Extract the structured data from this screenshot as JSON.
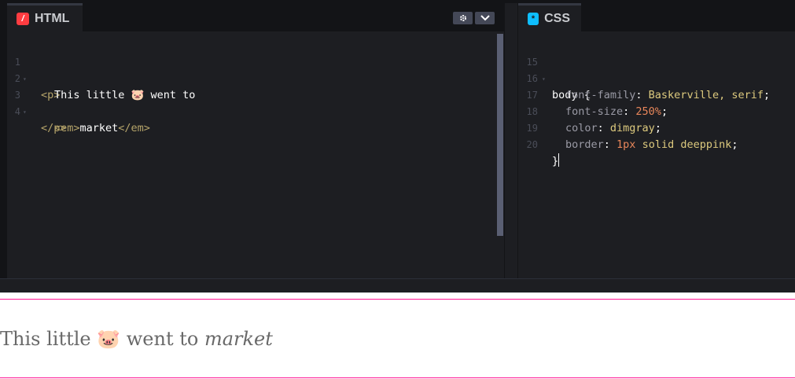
{
  "html_panel": {
    "tab_label": "HTML",
    "tab_icon": "/",
    "settings_icon": "gear-icon",
    "collapse_icon": "chevron-down-icon",
    "lines": [
      {
        "num": "1",
        "open": "<p>"
      },
      {
        "num": "2",
        "text_before": "This little ",
        "emoji": "🐷",
        "text_after": " went to"
      },
      {
        "num": "3",
        "open": "<em>",
        "inner": "market",
        "close": "</em>"
      },
      {
        "num": "4",
        "close": "</p>"
      }
    ]
  },
  "css_panel": {
    "tab_label": "CSS",
    "tab_icon": "*",
    "lines": [
      {
        "num": "15",
        "selector": "body",
        "brace": " {"
      },
      {
        "num": "16",
        "prop": "font-family",
        "value": "Baskerville, serif"
      },
      {
        "num": "17",
        "prop": "font-size",
        "value_num": "250%"
      },
      {
        "num": "18",
        "prop": "color",
        "value": "dimgray"
      },
      {
        "num": "19",
        "prop": "border",
        "value_num": "1px",
        "value": "solid deeppink"
      },
      {
        "num": "20",
        "brace": "}"
      }
    ]
  },
  "preview": {
    "text_before": "This little ",
    "emoji": "🐷",
    "text_after": " went to ",
    "em_text": "market"
  },
  "colors": {
    "editor_bg": "#1d1e22",
    "chrome_bg": "#131417",
    "html_icon": "#ff3c41",
    "css_icon": "#0ebeff",
    "preview_border": "deeppink",
    "preview_text": "dimgray"
  }
}
